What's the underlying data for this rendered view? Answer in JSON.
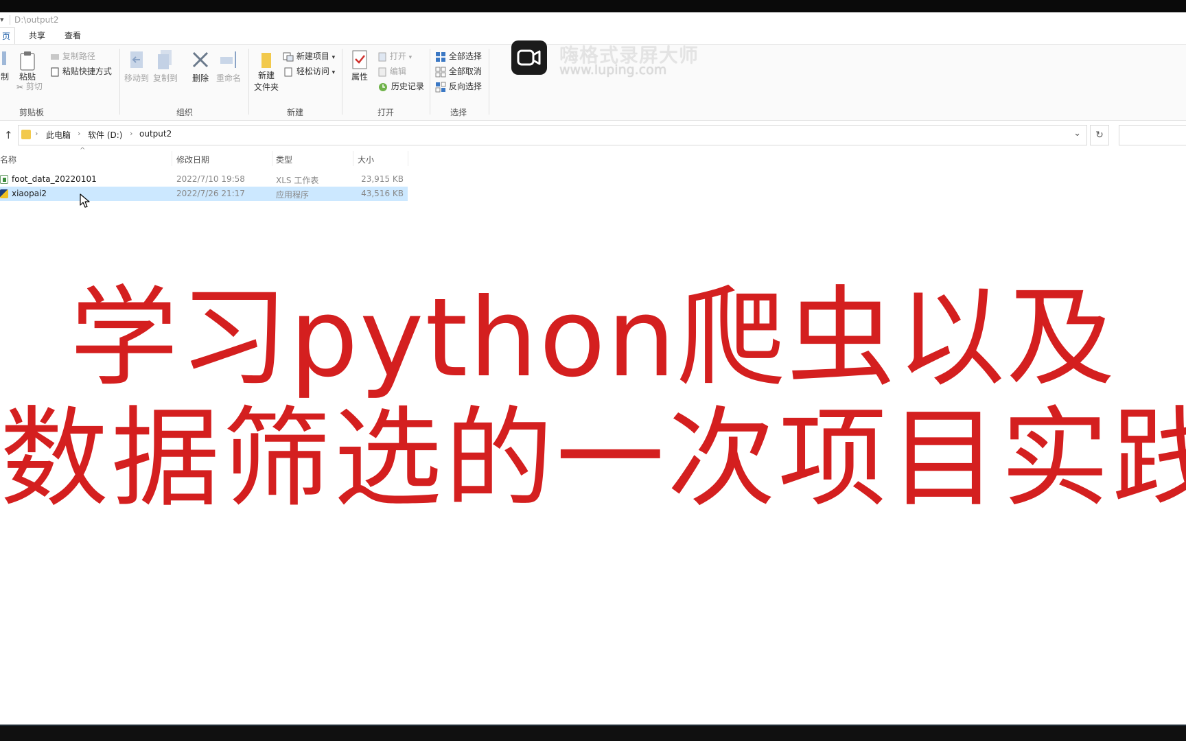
{
  "window": {
    "path": "D:\\output2"
  },
  "ribbon": {
    "tabs": [
      "页",
      "共享",
      "查看"
    ],
    "clipboard": {
      "cut_left": "制",
      "paste": "粘贴",
      "copy_path": "复制路径",
      "paste_shortcut": "粘贴快捷方式",
      "cut": "剪切",
      "label": "剪贴板"
    },
    "organize": {
      "move_to": "移动到",
      "copy_to": "复制到",
      "delete": "删除",
      "rename": "重命名",
      "label": "组织"
    },
    "new": {
      "new_folder_line1": "新建",
      "new_folder_line2": "文件夹",
      "new_item": "新建项目",
      "easy_access": "轻松访问",
      "label": "新建"
    },
    "open": {
      "properties": "属性",
      "open": "打开",
      "edit": "编辑",
      "history": "历史记录",
      "label": "打开"
    },
    "select": {
      "select_all": "全部选择",
      "select_none": "全部取消",
      "invert": "反向选择",
      "label": "选择"
    }
  },
  "watermark": {
    "title": "嗨格式录屏大师",
    "url": "www.luping.com"
  },
  "address": {
    "crumbs": [
      "此电脑",
      "软件 (D:)",
      "output2"
    ]
  },
  "filelist": {
    "columns": {
      "name": "名称",
      "date": "修改日期",
      "type": "类型",
      "size": "大小"
    },
    "rows": [
      {
        "name": "foot_data_20220101",
        "date": "2022/7/10 19:58",
        "type": "XLS 工作表",
        "size": "23,915 KB",
        "icon": "xls-file-icon",
        "selected": false
      },
      {
        "name": "xiaopai2",
        "date": "2022/7/26 21:17",
        "type": "应用程序",
        "size": "43,516 KB",
        "icon": "exe-file-icon",
        "selected": true
      }
    ]
  },
  "caption": {
    "line1": "学习python爬虫以及",
    "line2": "数据筛选的一次项目实践",
    "color": "#d41f1f"
  }
}
